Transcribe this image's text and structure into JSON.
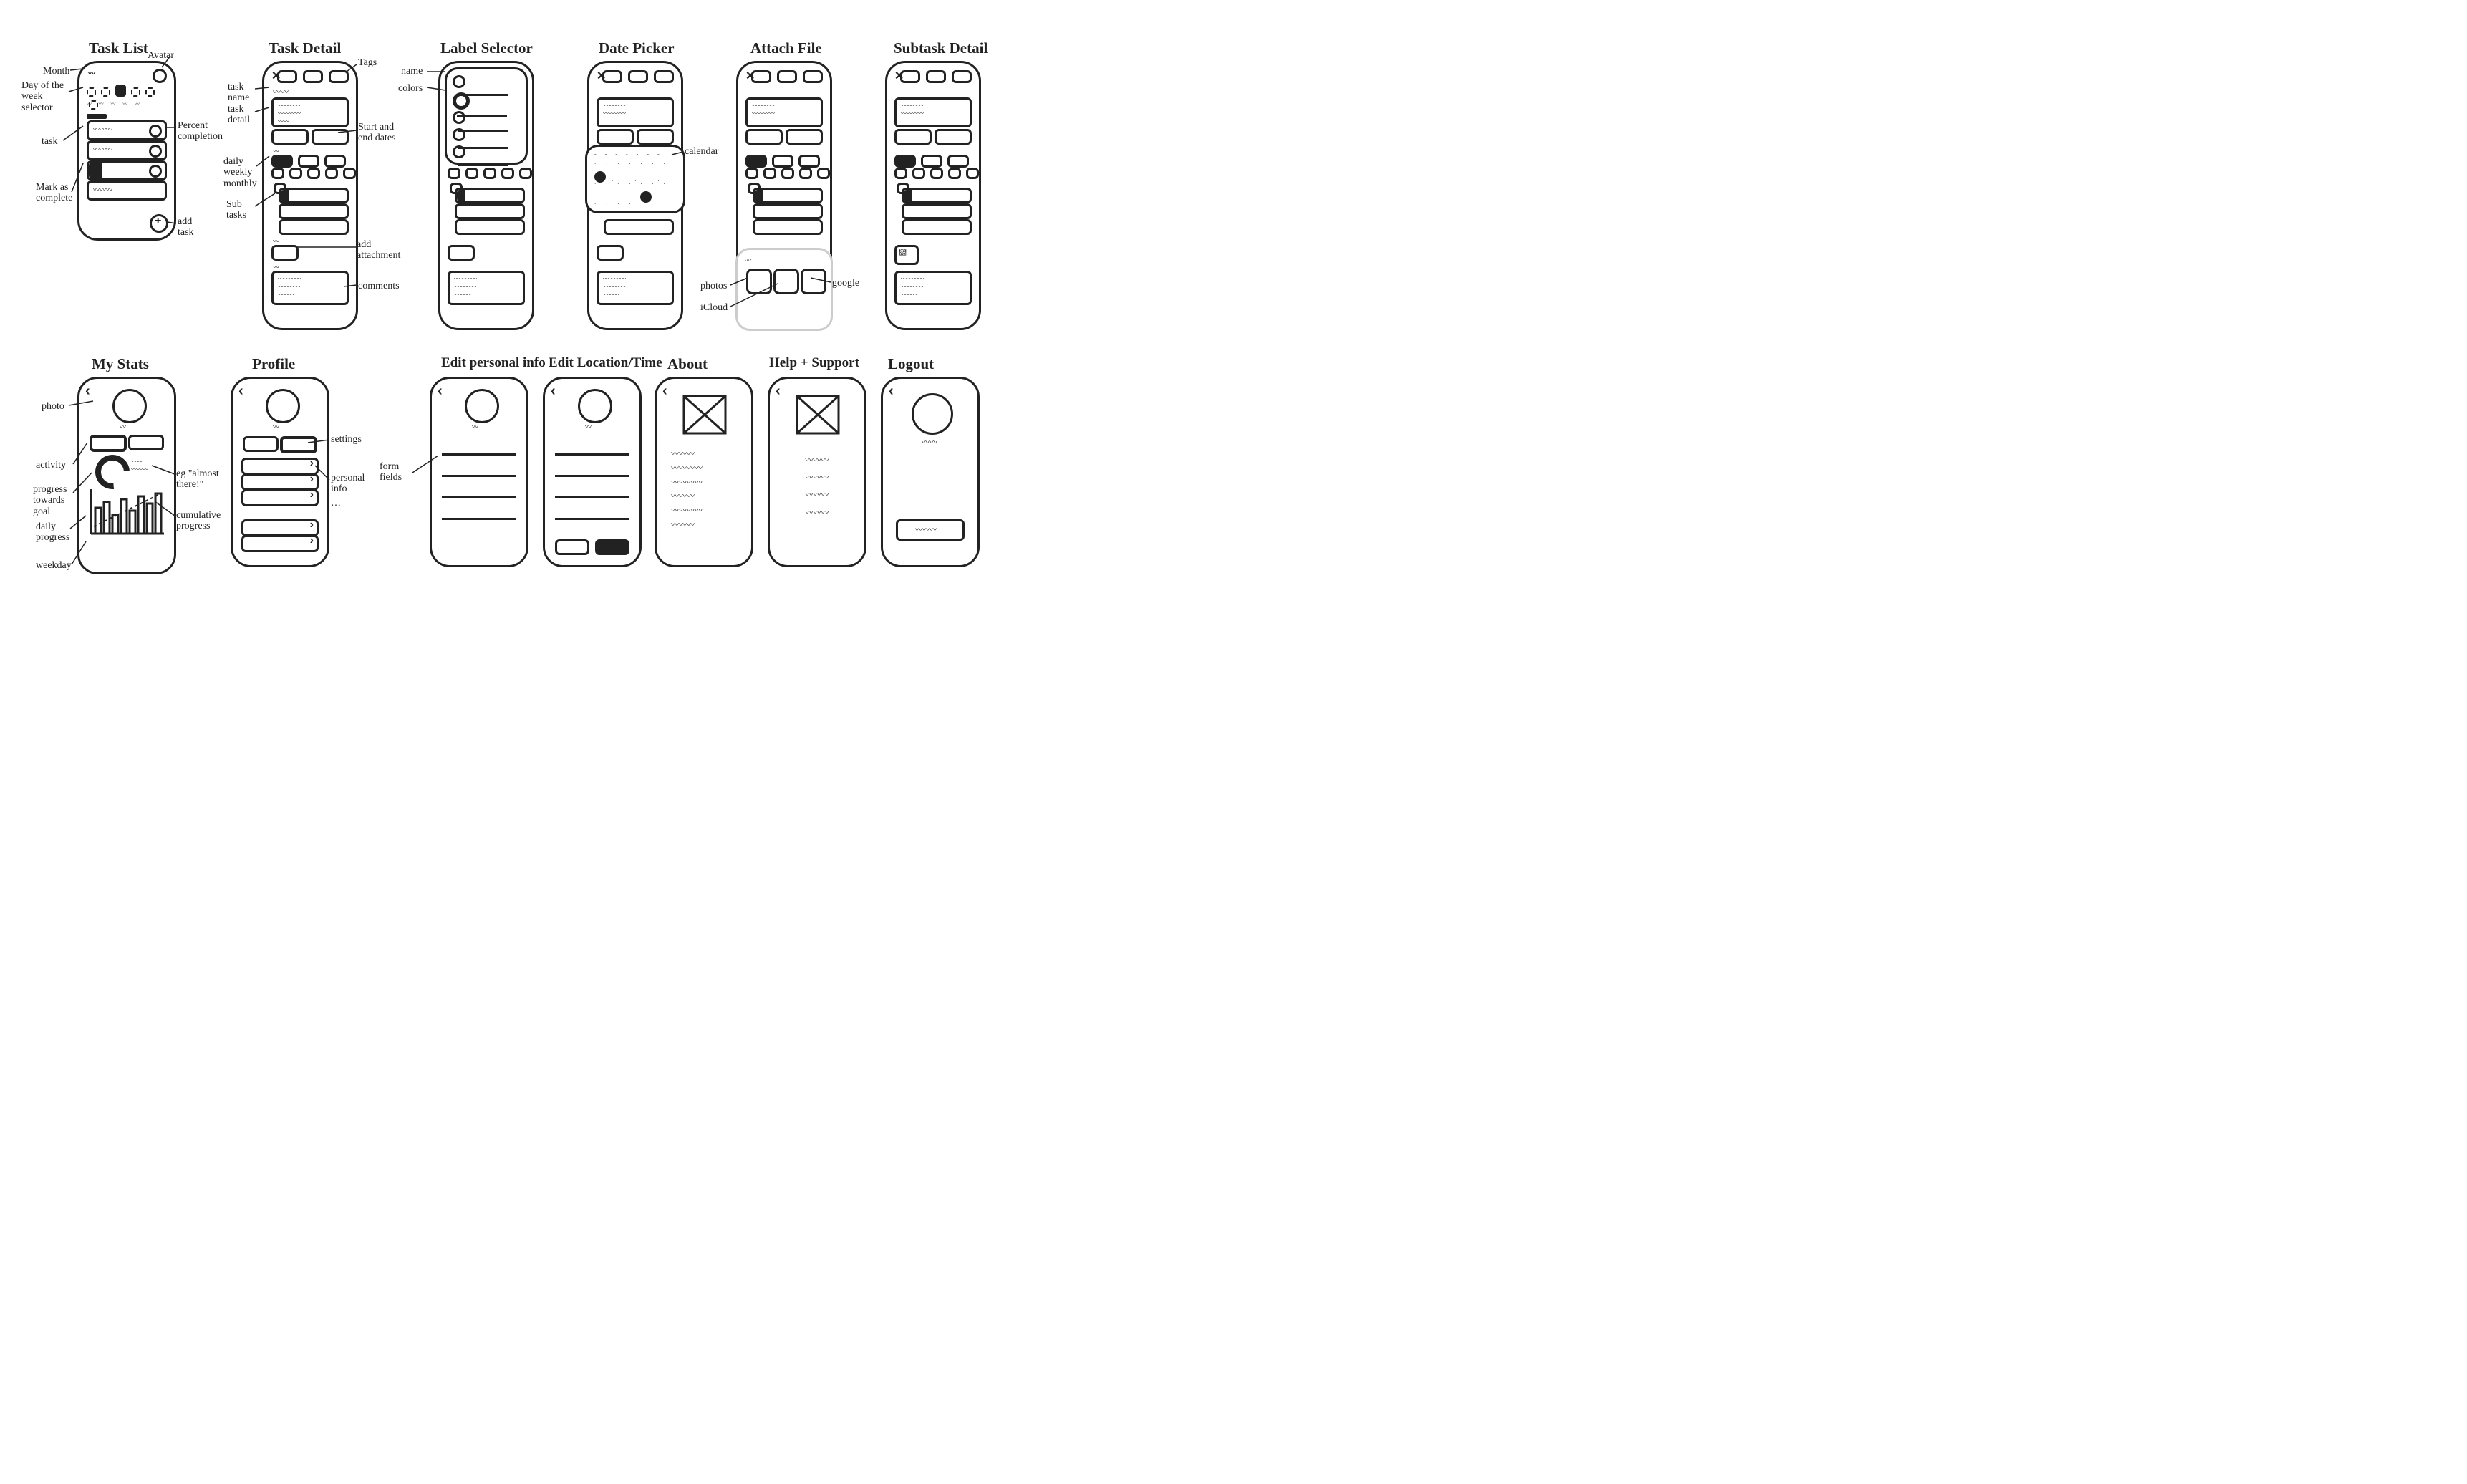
{
  "screens": {
    "task_list": {
      "title": "Task List"
    },
    "task_detail": {
      "title": "Task Detail"
    },
    "label_selector": {
      "title": "Label Selector"
    },
    "date_picker": {
      "title": "Date Picker"
    },
    "attach_file": {
      "title": "Attach File"
    },
    "subtask_detail": {
      "title": "Subtask Detail"
    },
    "my_stats": {
      "title": "My Stats"
    },
    "profile": {
      "title": "Profile"
    },
    "edit_personal": {
      "title": "Edit personal info"
    },
    "edit_location": {
      "title": "Edit Location/Time"
    },
    "about": {
      "title": "About"
    },
    "help": {
      "title": "Help + Support"
    },
    "logout": {
      "title": "Logout"
    }
  },
  "annotations": {
    "month": "Month",
    "avatar": "Avatar",
    "day_selector": "Day of the week selector",
    "task": "task",
    "percent": "Percent completion",
    "mark_complete": "Mark as complete",
    "add_task": "add task",
    "tags": "Tags",
    "task_name": "task name",
    "task_detail": "task detail",
    "start_end": "Start and end dates",
    "dwm": "daily weekly monthly",
    "subtasks": "Sub tasks",
    "add_attachment": "add attachment",
    "comments": "comments",
    "label_name": "name",
    "label_colors": "colors",
    "calendar": "calendar",
    "photos": "photos",
    "icloud": "iCloud",
    "google": "google",
    "photo_label": "photo",
    "activity": "activity",
    "eg_almost": "eg \"almost there!\"",
    "progress_goal": "progress towards goal",
    "cumulative": "cumulative progress",
    "daily_progress": "daily progress",
    "weekday": "weekday",
    "settings": "settings",
    "personal_info": "personal info",
    "ellipsis": "…",
    "form_fields": "form fields"
  }
}
